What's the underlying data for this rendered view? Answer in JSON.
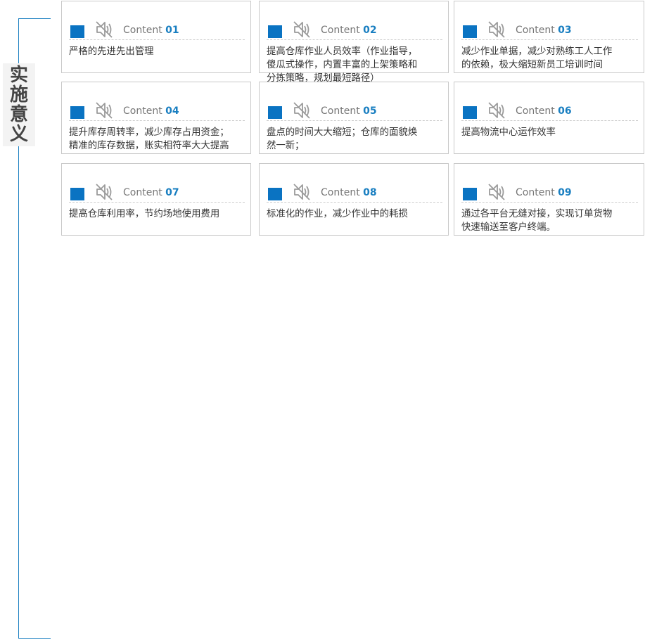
{
  "side_title": [
    "实",
    "施",
    "意",
    "义"
  ],
  "content_prefix": "Content",
  "accent_color": "#0a73c2",
  "icon": "speaker-mute-icon",
  "cards": [
    {
      "num": "01",
      "text": "严格的先进先出管理"
    },
    {
      "num": "04",
      "text": "提升库存周转率，减少库存占用资金；\n精准的库存数据，账实相符率大大提高"
    },
    {
      "num": "07",
      "text": "提高仓库利用率，节约场地使用费用"
    },
    {
      "num": "02",
      "text": "提高仓库作业人员效率（作业指导，\n傻瓜式操作，内置丰富的上架策略和\n分拣策略，规划最短路径）"
    },
    {
      "num": "05",
      "text": "盘点的时间大大缩短；仓库的面貌焕\n然一新；"
    },
    {
      "num": "08",
      "text": "标准化的作业，减少作业中的耗损"
    },
    {
      "num": "03",
      "text": "减少作业单据，减少对熟练工人工作\n的依赖，极大缩短新员工培训时间"
    },
    {
      "num": "06",
      "text": "提高物流中心运作效率"
    },
    {
      "num": "09",
      "text": "通过各平台无缝对接，实现订单货物\n快速输送至客户终端。"
    }
  ]
}
